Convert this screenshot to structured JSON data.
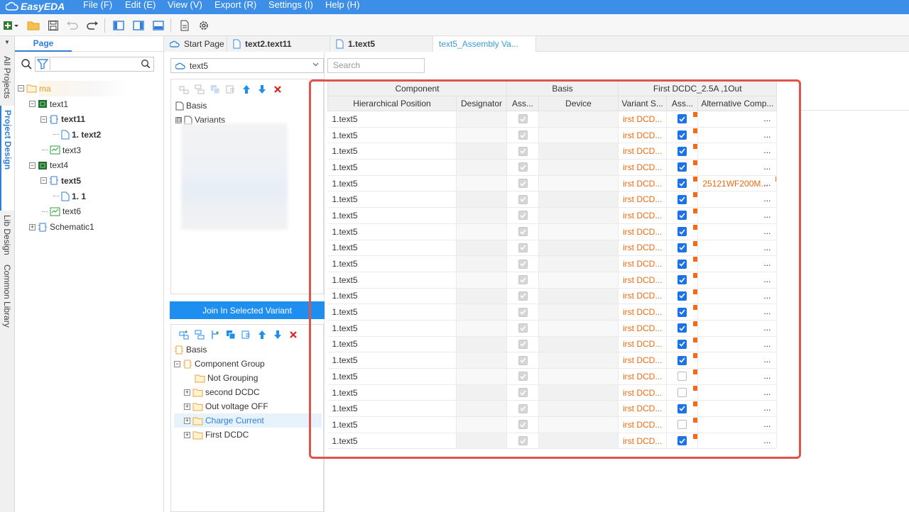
{
  "app": {
    "logo_text": "EasyEDA",
    "menus": [
      "File (F)",
      "Edit (E)",
      "View (V)",
      "Export (R)",
      "Settings (I)",
      "Help (H)"
    ]
  },
  "toolbar": {
    "icons": [
      "new-icon",
      "folder-icon",
      "save-icon",
      "undo-icon",
      "redo-icon",
      "left-panel-icon",
      "right-panel-icon",
      "bottom-panel-icon",
      "document-icon",
      "gear-icon"
    ]
  },
  "vtabs": {
    "pin": "▼",
    "items": [
      "All Projects",
      "Project Design",
      "Lib Design",
      "Common Library"
    ],
    "active": "Project Design"
  },
  "project_panel": {
    "tab_label": "Page",
    "search_placeholder": "",
    "tree": [
      {
        "label": "ma",
        "level": 0,
        "expander": "⊟",
        "icon": "folder-icon",
        "bold": false,
        "blurred": true
      },
      {
        "label": "text1",
        "level": 1,
        "expander": "⊟",
        "icon": "board-icon",
        "bold": false
      },
      {
        "label": "text11",
        "level": 2,
        "expander": "⊟",
        "icon": "schematic-icon",
        "bold": true
      },
      {
        "label": "1. text2",
        "level": 3,
        "expander": "",
        "icon": "page-icon",
        "bold": true
      },
      {
        "label": "text3",
        "level": 2,
        "expander": "",
        "icon": "pcb-icon",
        "bold": false
      },
      {
        "label": "text4",
        "level": 1,
        "expander": "⊟",
        "icon": "board-icon",
        "bold": false
      },
      {
        "label": "text5",
        "level": 2,
        "expander": "⊟",
        "icon": "schematic-icon",
        "bold": true
      },
      {
        "label": "1. 1",
        "level": 3,
        "expander": "",
        "icon": "page-icon",
        "bold": true
      },
      {
        "label": "text6",
        "level": 2,
        "expander": "",
        "icon": "pcb-icon",
        "bold": false
      },
      {
        "label": "Schematic1",
        "level": 1,
        "expander": "⊞",
        "icon": "schematic-icon",
        "bold": false
      }
    ]
  },
  "doc_tabs": [
    {
      "label": "Start Page",
      "icon": "home-cloud-icon",
      "bold": false,
      "active": false
    },
    {
      "label": "text2.text11",
      "icon": "doc-icon",
      "bold": true,
      "active": false
    },
    {
      "label": "1.text5",
      "icon": "doc-icon",
      "bold": true,
      "active": false
    },
    {
      "label": "text5_Assembly Va...",
      "icon": "",
      "bold": false,
      "active": true
    }
  ],
  "variant_panel": {
    "selected": "text5",
    "top_tree": [
      {
        "label": "Basis",
        "icon": "doc-icon",
        "expander": ""
      },
      {
        "label": "Variants",
        "icon": "doc-icon",
        "expander": "⊟"
      }
    ],
    "join_button": "Join In Selected Variant",
    "bottom_tree": [
      {
        "label": "Basis",
        "icon": "component-icon",
        "expander": "",
        "level": 0,
        "highlight": false
      },
      {
        "label": "Component Group",
        "icon": "component-icon",
        "expander": "⊟",
        "level": 0,
        "highlight": false
      },
      {
        "label": "Not Grouping",
        "icon": "folder-icon",
        "expander": "",
        "level": 1,
        "highlight": false
      },
      {
        "label": "second DCDC",
        "icon": "folder-icon",
        "expander": "⊞",
        "level": 1,
        "highlight": false
      },
      {
        "label": "Out voltage OFF",
        "icon": "folder-icon",
        "expander": "⊞",
        "level": 1,
        "highlight": false
      },
      {
        "label": "Charge Current",
        "icon": "folder-icon",
        "expander": "⊞",
        "level": 1,
        "highlight": true
      },
      {
        "label": "First DCDC",
        "icon": "folder-icon",
        "expander": "⊞",
        "level": 1,
        "highlight": false
      }
    ]
  },
  "search": {
    "placeholder": "Search"
  },
  "table": {
    "groups": [
      "Component",
      "Basis",
      "First DCDC_2.5A ,1Out"
    ],
    "columns": [
      "Hierarchical Position",
      "Designator",
      "Ass...",
      "Device",
      "Variant S...",
      "Ass...",
      "Alternative Comp..."
    ],
    "variant_value": "irst DCD...",
    "dots": "...",
    "rows": [
      {
        "pos": "1.text5",
        "checked": true,
        "alt": ""
      },
      {
        "pos": "1.text5",
        "checked": true,
        "alt": ""
      },
      {
        "pos": "1.text5",
        "checked": true,
        "alt": ""
      },
      {
        "pos": "1.text5",
        "checked": true,
        "alt": ""
      },
      {
        "pos": "1.text5",
        "checked": true,
        "alt": "25121WF200M..."
      },
      {
        "pos": "1.text5",
        "checked": true,
        "alt": ""
      },
      {
        "pos": "1.text5",
        "checked": true,
        "alt": ""
      },
      {
        "pos": "1.text5",
        "checked": true,
        "alt": ""
      },
      {
        "pos": "1.text5",
        "checked": true,
        "alt": ""
      },
      {
        "pos": "1.text5",
        "checked": true,
        "alt": ""
      },
      {
        "pos": "1.text5",
        "checked": true,
        "alt": ""
      },
      {
        "pos": "1.text5",
        "checked": true,
        "alt": ""
      },
      {
        "pos": "1.text5",
        "checked": true,
        "alt": ""
      },
      {
        "pos": "1.text5",
        "checked": true,
        "alt": ""
      },
      {
        "pos": "1.text5",
        "checked": true,
        "alt": ""
      },
      {
        "pos": "1.text5",
        "checked": true,
        "alt": ""
      },
      {
        "pos": "1.text5",
        "checked": false,
        "alt": ""
      },
      {
        "pos": "1.text5",
        "checked": false,
        "alt": ""
      },
      {
        "pos": "1.text5",
        "checked": true,
        "alt": ""
      },
      {
        "pos": "1.text5",
        "checked": false,
        "alt": ""
      },
      {
        "pos": "1.text5",
        "checked": true,
        "alt": ""
      }
    ]
  },
  "colors": {
    "menubar": "#3d8ee6",
    "accent": "#2f7ed8",
    "orange": "#e86a12",
    "highlight_box": "#e2534b",
    "join_button": "#1f8ef1"
  }
}
